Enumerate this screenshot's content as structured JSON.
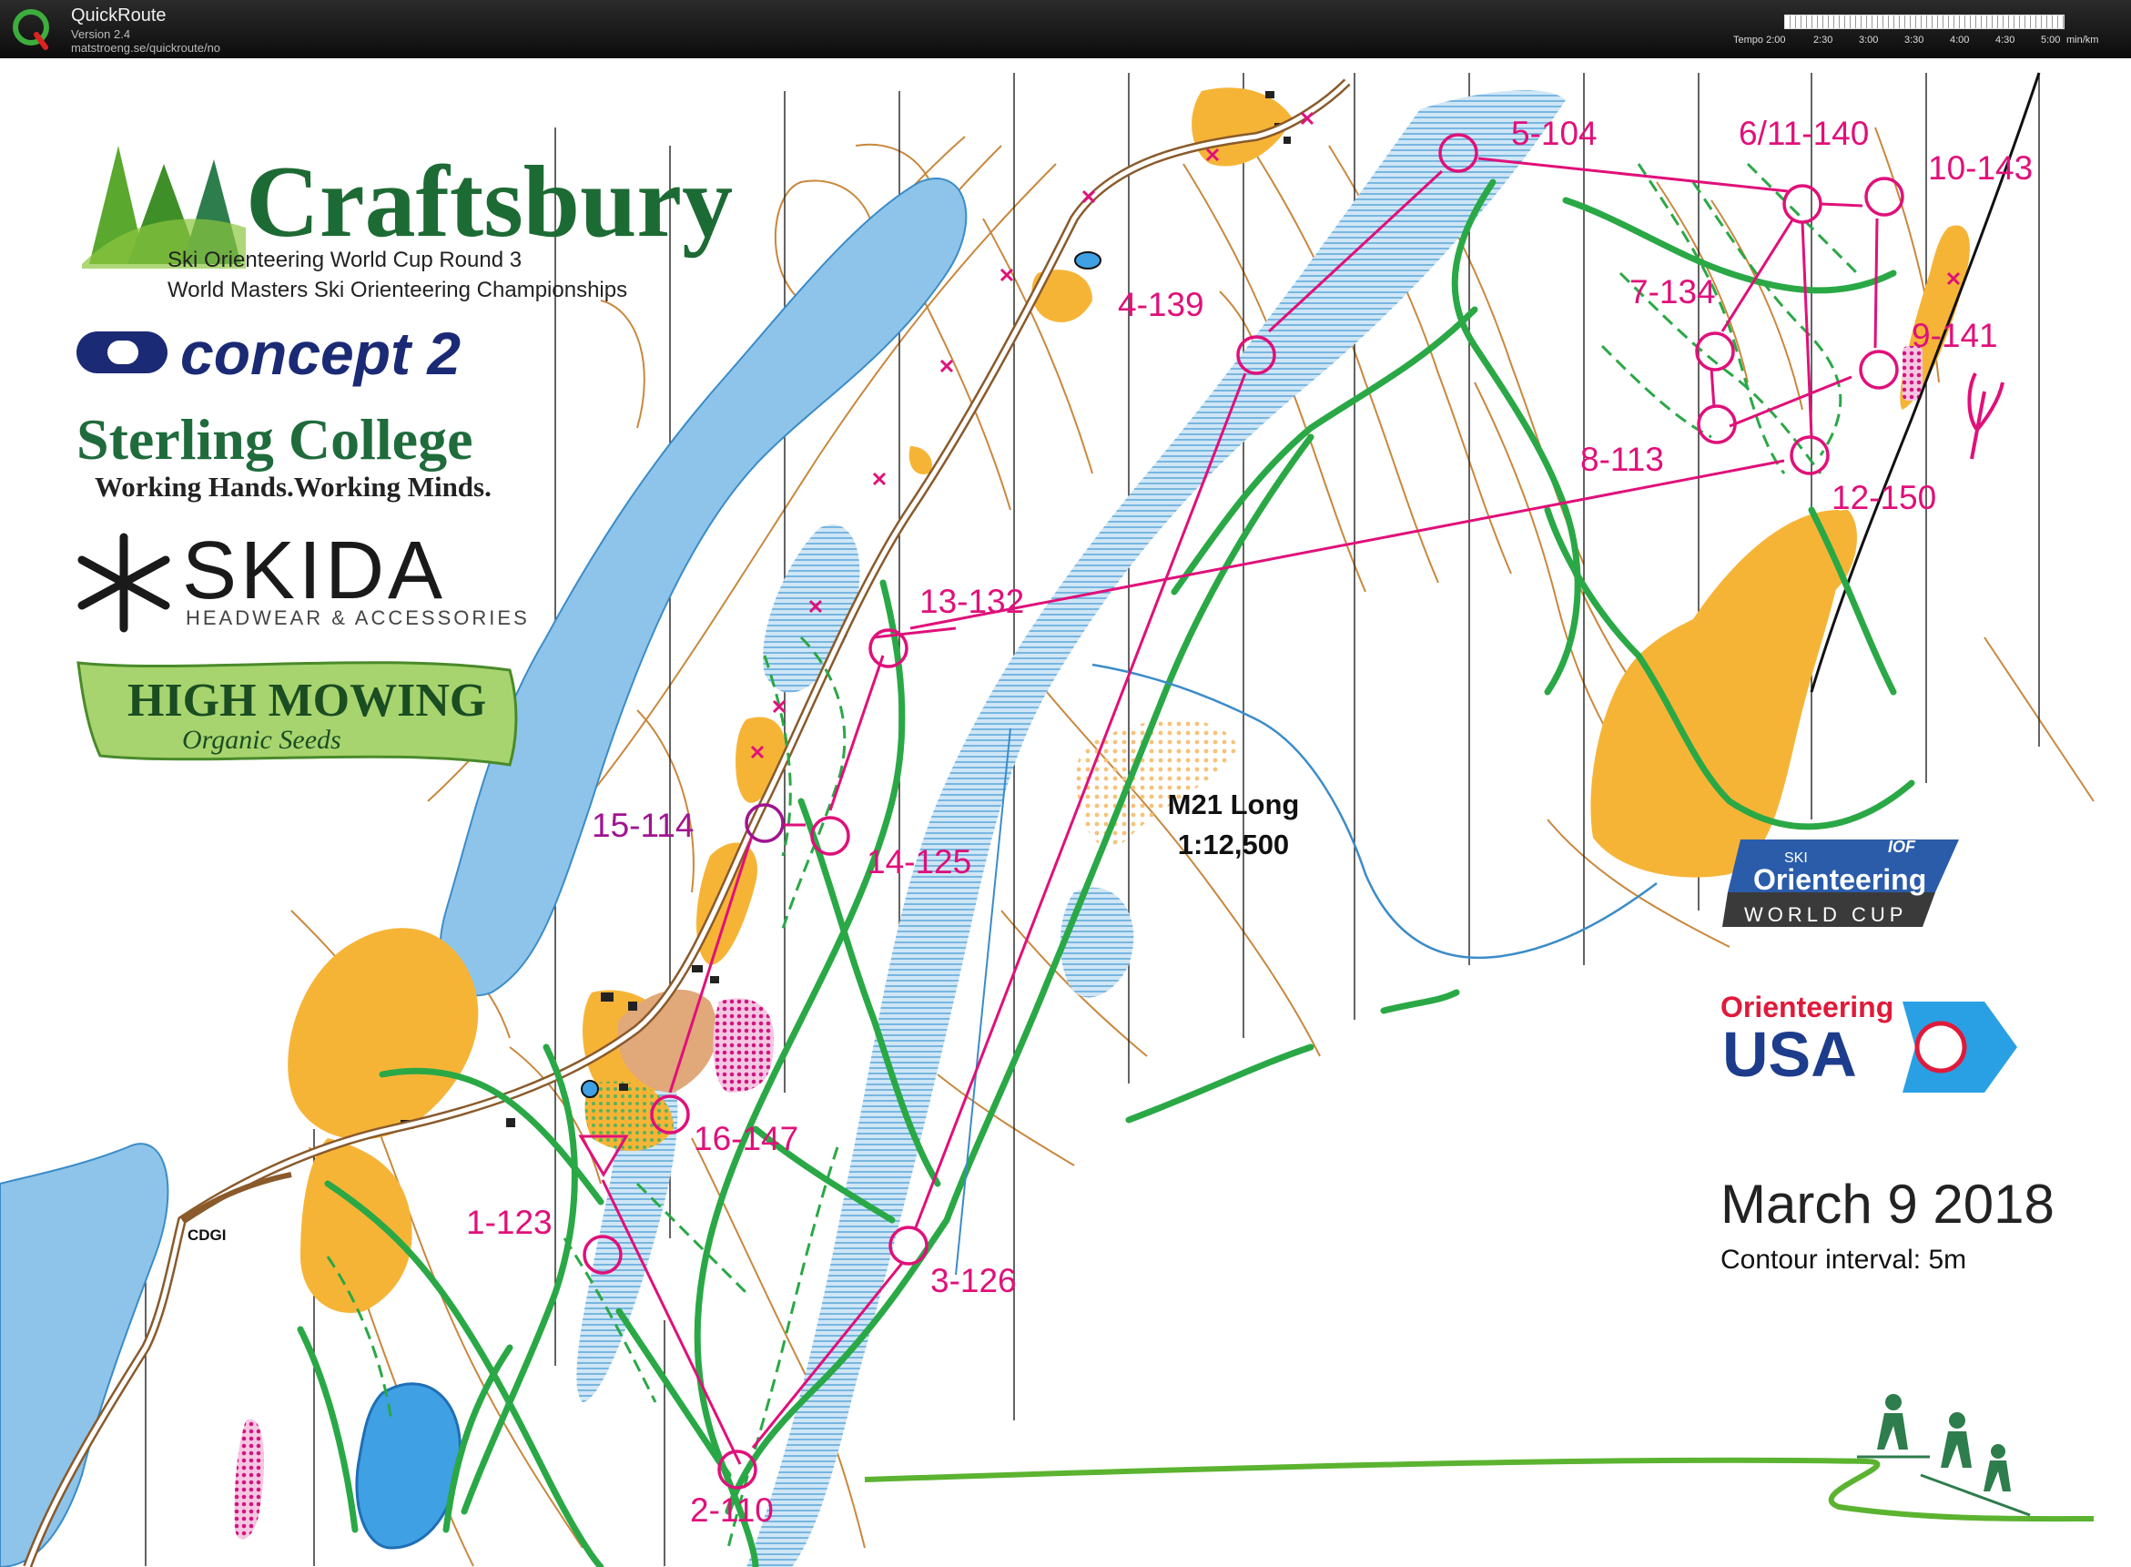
{
  "app": {
    "name": "QuickRoute",
    "version": "Version 2.4",
    "url": "matstroeng.se/quickroute/no"
  },
  "tempo_scale": {
    "label": "Tempo 2:00",
    "ticks": [
      "2:30",
      "3:00",
      "3:30",
      "4:00",
      "4:30",
      "5:00"
    ],
    "unit": "min/km"
  },
  "map": {
    "title_line1": "M21 Long",
    "title_line2": "1:12,500",
    "date": "March 9  2018",
    "contour_interval": "Contour interval: 5m",
    "place_label": "CDGI"
  },
  "sponsors": {
    "craftsbury": {
      "title": "Craftsbury",
      "sub1": "Ski Orienteering World Cup Round 3",
      "sub2": "World Masters Ski Orienteering Championships"
    },
    "concept2": "concept 2",
    "sterling": {
      "title": "Sterling College",
      "tagline": "Working Hands.Working Minds."
    },
    "skida": {
      "title": "SKIDA",
      "tagline": "HEADWEAR & ACCESSORIES"
    },
    "high_mowing": {
      "title": "HIGH MOWING",
      "tagline": "Organic Seeds"
    },
    "world_cup": {
      "iof": "IOF",
      "ski": "SKI",
      "orienteering": "Orienteering",
      "world_cup": "WORLD CUP"
    },
    "orienteering_usa": {
      "line1": "Orienteering",
      "line2": "USA"
    }
  },
  "course": {
    "controls": [
      {
        "label": "1-123",
        "highlight": false
      },
      {
        "label": "2-110",
        "highlight": false
      },
      {
        "label": "3-126",
        "highlight": false
      },
      {
        "label": "4-139",
        "highlight": false
      },
      {
        "label": "5-104",
        "highlight": false
      },
      {
        "label": "6/11-140",
        "highlight": false
      },
      {
        "label": "7-134",
        "highlight": false
      },
      {
        "label": "8-113",
        "highlight": false
      },
      {
        "label": "9-141",
        "highlight": false
      },
      {
        "label": "10-143",
        "highlight": false
      },
      {
        "label": "12-150",
        "highlight": false
      },
      {
        "label": "13-132",
        "highlight": false
      },
      {
        "label": "14-125",
        "highlight": false
      },
      {
        "label": "15-114",
        "highlight": true
      },
      {
        "label": "16-147",
        "highlight": false
      }
    ]
  },
  "colors": {
    "course": "#e0107a",
    "trail": "#2aa846",
    "water": "#8ec4ea",
    "open_land": "#f6b437",
    "contour": "#c9883e"
  }
}
